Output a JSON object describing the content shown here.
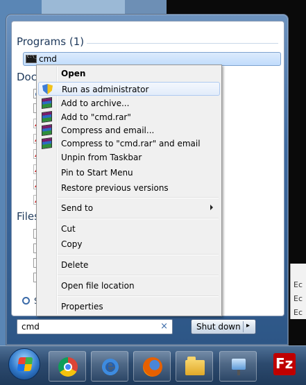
{
  "start_menu": {
    "programs_header": "Programs (1)",
    "program_result": {
      "label": "cmd",
      "icon": "cmd-icon"
    },
    "documents_header": "Docu",
    "files_header": "Files",
    "search_more_link": "Se"
  },
  "context_menu": {
    "items": [
      {
        "label": "Open",
        "bold": true
      },
      {
        "label": "Run as administrator",
        "icon": "shield-icon",
        "hover": true
      },
      {
        "label": "Add to archive...",
        "icon": "winrar-icon"
      },
      {
        "label": "Add to \"cmd.rar\"",
        "icon": "winrar-icon"
      },
      {
        "label": "Compress and email...",
        "icon": "winrar-icon"
      },
      {
        "label": "Compress to \"cmd.rar\" and email",
        "icon": "winrar-icon"
      },
      {
        "label": "Unpin from Taskbar"
      },
      {
        "label": "Pin to Start Menu"
      },
      {
        "label": "Restore previous versions"
      },
      {
        "label": "Send to",
        "submenu": true
      },
      {
        "label": "Cut"
      },
      {
        "label": "Copy"
      },
      {
        "label": "Delete"
      },
      {
        "label": "Open file location"
      },
      {
        "label": "Properties"
      }
    ]
  },
  "search": {
    "value": "cmd",
    "clear_icon": "×"
  },
  "shutdown": {
    "label": "Shut down",
    "arrow": "▸"
  },
  "desktop_window_fragment": {
    "lines": [
      "Ec",
      "Ec",
      "Ec"
    ]
  },
  "taskbar": {
    "items": [
      "start-orb",
      "chrome-icon",
      "internet-explorer-icon",
      "firefox-icon",
      "windows-explorer-icon",
      "network-icon",
      "filezilla-icon"
    ]
  }
}
